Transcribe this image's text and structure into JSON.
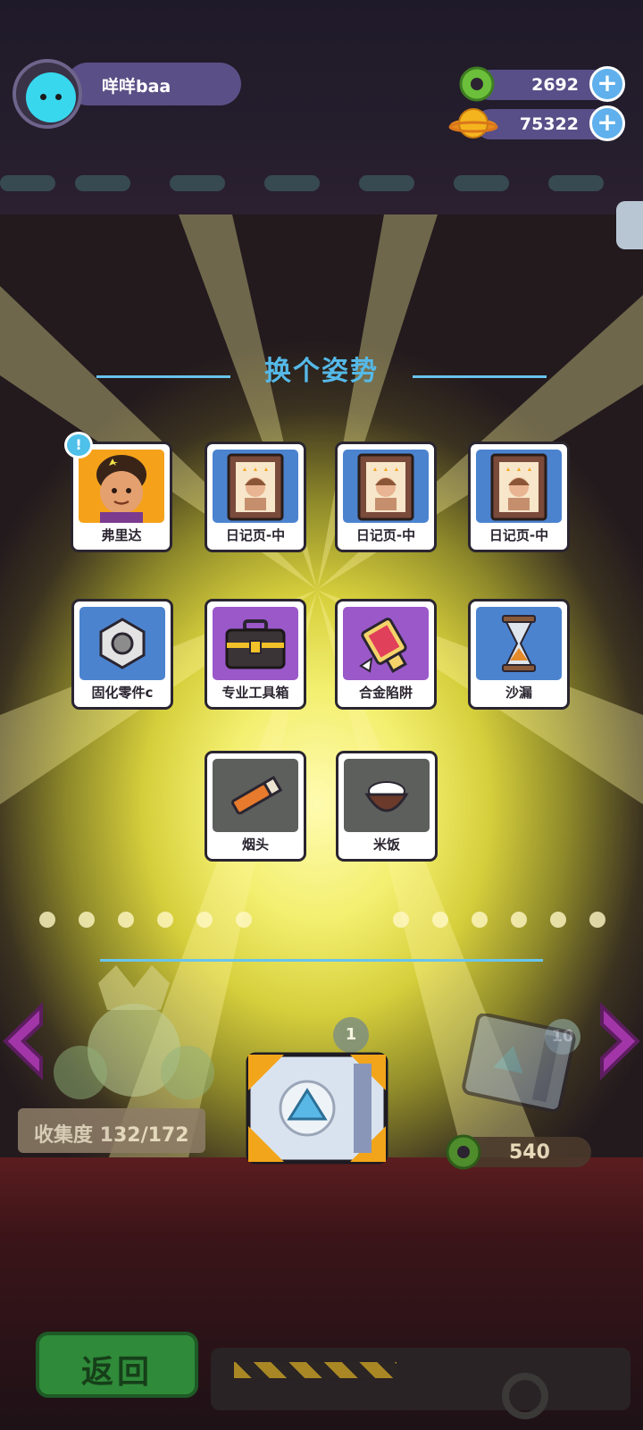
{
  "player": {
    "name": "咩咩baa"
  },
  "currencies": [
    {
      "icon": "green-donut-coin-icon",
      "value": "2692"
    },
    {
      "icon": "orange-planet-coin-icon",
      "value": "75322"
    }
  ],
  "reward_panel": {
    "title": "换个姿势",
    "items": [
      {
        "label": "弗里达",
        "icon": "frida-character-icon",
        "bg": "#f5a21a",
        "notice": "!"
      },
      {
        "label": "日记页-中",
        "icon": "diary-page-portrait-icon",
        "bg": "#4b83cf"
      },
      {
        "label": "日记页-中",
        "icon": "diary-page-portrait-icon",
        "bg": "#4b83cf"
      },
      {
        "label": "日记页-中",
        "icon": "diary-page-portrait-icon",
        "bg": "#4b83cf"
      },
      {
        "label": "固化零件c",
        "icon": "hex-nut-icon",
        "bg": "#4b83cf"
      },
      {
        "label": "专业工具箱",
        "icon": "toolbox-icon",
        "bg": "#9a58c9"
      },
      {
        "label": "合金陷阱",
        "icon": "alloy-trap-icon",
        "bg": "#9a58c9"
      },
      {
        "label": "沙漏",
        "icon": "hourglass-icon",
        "bg": "#4b83cf"
      },
      {
        "label": "烟头",
        "icon": "cigarette-butt-icon",
        "bg": "#5d5f5d"
      },
      {
        "label": "米饭",
        "icon": "rice-bowl-icon",
        "bg": "#5d5f5d"
      }
    ]
  },
  "background": {
    "collection": "收集度 132/172",
    "single_draw_count": "1",
    "ten_draw_count": "10",
    "ten_draw_price": "540"
  },
  "back_button": {
    "label": "返回"
  }
}
